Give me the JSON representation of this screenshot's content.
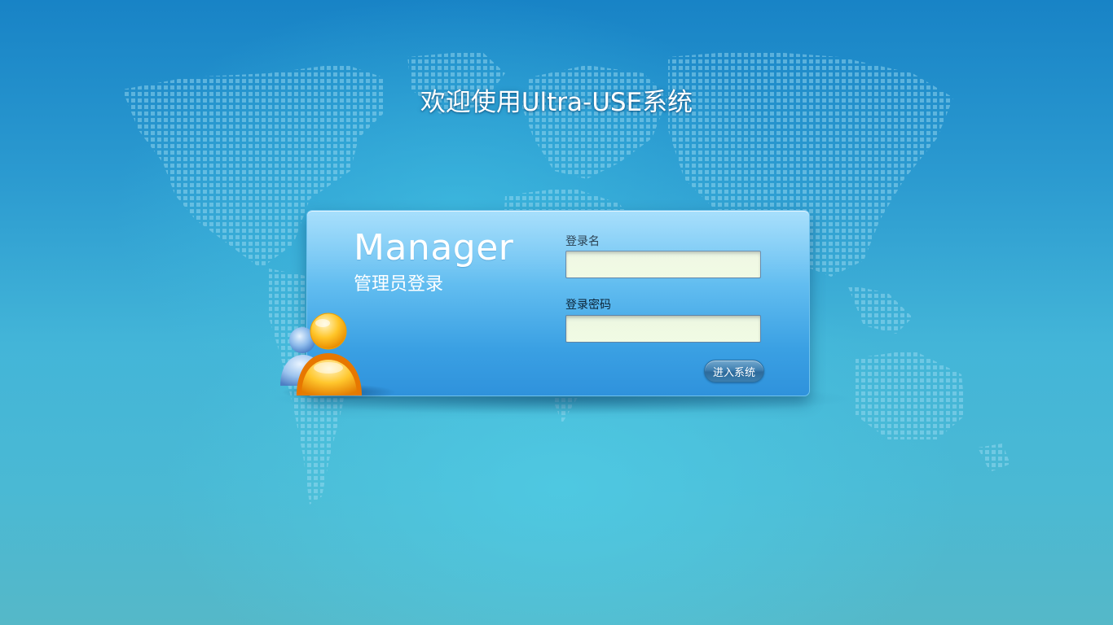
{
  "page": {
    "welcome_title": "欢迎使用Ultra-USE系统"
  },
  "login": {
    "title": "Manager",
    "subtitle": "管理员登录",
    "username_label": "登录名",
    "username_value": "",
    "password_label": "登录密码",
    "password_value": "",
    "submit_label": "进入系统"
  },
  "icons": {
    "avatar": "users-icon",
    "background": "world-map"
  },
  "colors": {
    "background_top": "#1883c6",
    "background_bottom": "#55b8c8",
    "panel": "#4aaae6",
    "input_fill": "#f1fbe4",
    "button": "#3f7fb0"
  }
}
